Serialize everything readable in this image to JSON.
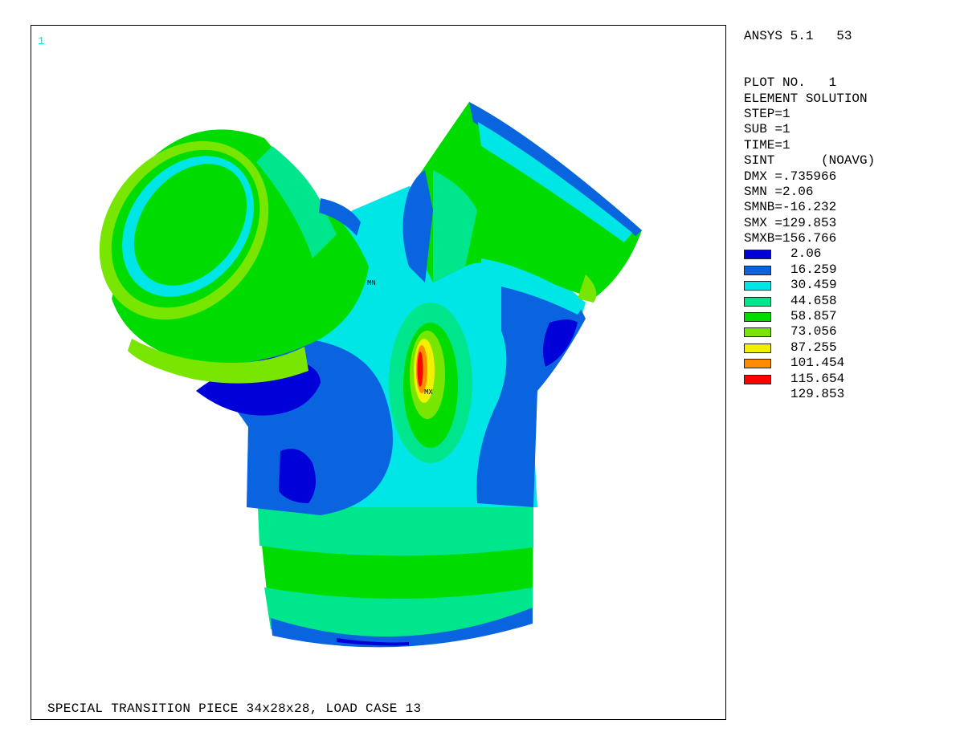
{
  "viewport": {
    "window_number": "1",
    "caption": "SPECIAL TRANSITION PIECE 34x28x28, LOAD CASE 13",
    "min_marker": "MN",
    "max_marker": "MX"
  },
  "info": {
    "version": "ANSYS 5.1",
    "page_code": "53",
    "lines": [
      "PLOT NO.   1",
      "ELEMENT SOLUTION",
      "STEP=1",
      "SUB =1",
      "TIME=1",
      "SINT      (NOAVG)",
      "DMX =.735966",
      "SMN =2.06",
      "SMNB=-16.232",
      "SMX =129.853",
      "SMXB=156.766"
    ]
  },
  "legend": {
    "values": [
      "2.06",
      "16.259",
      "30.459",
      "44.658",
      "58.857",
      "73.056",
      "87.255",
      "101.454",
      "115.654",
      "129.853"
    ],
    "colors": [
      "#0000d8",
      "#0a64e0",
      "#00e6e6",
      "#00e68c",
      "#00dc00",
      "#78e600",
      "#f0f000",
      "#ff8c00",
      "#ff0000",
      ""
    ]
  },
  "palette": {
    "blue": "#0000d8",
    "mid_blue": "#0a64e0",
    "cyan": "#00e6e6",
    "teal": "#00e68c",
    "green": "#00dc00",
    "yellow_green": "#78e600",
    "yellow": "#f0f000",
    "orange": "#ff8c00",
    "red": "#ff0000"
  }
}
